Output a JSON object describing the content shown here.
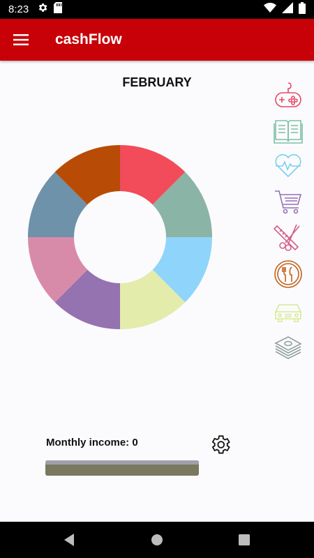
{
  "status_bar": {
    "time": "8:23"
  },
  "app_bar": {
    "title": "cashFlow"
  },
  "month": "FEBRUARY",
  "chart_data": {
    "type": "pie",
    "values": [
      1,
      1,
      1,
      1,
      1,
      1,
      1,
      1
    ],
    "colors": [
      "#f24b5a",
      "#8ab4a6",
      "#8fd4fb",
      "#e3ecab",
      "#9572b0",
      "#d88ba9",
      "#6e92a9",
      "#b84c06"
    ]
  },
  "categories": [
    {
      "icon": "gamepad-icon",
      "color": "#e24a66"
    },
    {
      "icon": "book-icon",
      "color": "#7cc0a4"
    },
    {
      "icon": "heart-pulse-icon",
      "color": "#7ad0ee"
    },
    {
      "icon": "shopping-cart-icon",
      "color": "#9570b5"
    },
    {
      "icon": "scissors-comb-icon",
      "color": "#d45f88"
    },
    {
      "icon": "restaurant-icon",
      "color": "#c2621c"
    },
    {
      "icon": "car-icon",
      "color": "#d4eb92"
    },
    {
      "icon": "money-icon",
      "color": "#8fa09a"
    }
  ],
  "income": {
    "label": "Monthly income: 0",
    "progress": 0
  }
}
